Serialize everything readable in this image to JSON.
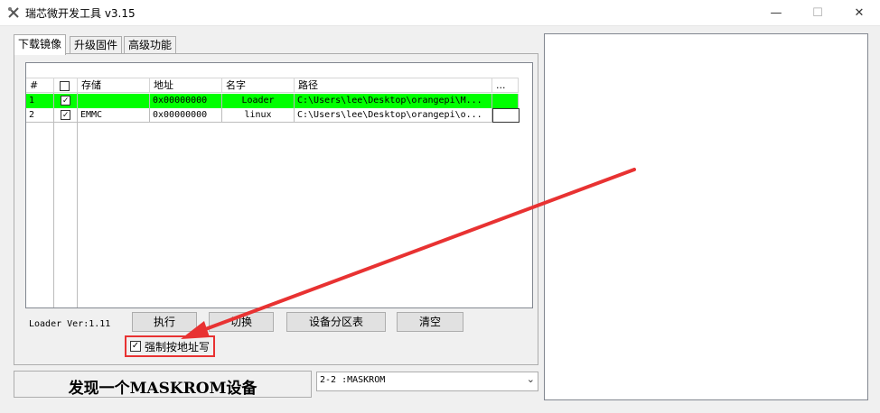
{
  "window": {
    "title": "瑞芯微开发工具 v3.15",
    "min_glyph": "—",
    "max_glyph": "☐",
    "close_glyph": "✕"
  },
  "tabs": [
    {
      "label": "下载镜像",
      "active": true
    },
    {
      "label": "升级固件",
      "active": false
    },
    {
      "label": "高级功能",
      "active": false
    }
  ],
  "table": {
    "columns": [
      "#",
      "",
      "存储",
      "地址",
      "名字",
      "路径",
      "..."
    ],
    "rows": [
      {
        "num": "1",
        "checked": true,
        "storage": "",
        "address": "0x00000000",
        "name": "Loader",
        "path": "C:\\Users\\lee\\Desktop\\orangepi\\M...",
        "selected": true
      },
      {
        "num": "2",
        "checked": true,
        "storage": "EMMC",
        "address": "0x00000000",
        "name": "linux",
        "path": "C:\\Users\\lee\\Desktop\\orangepi\\o...",
        "selected": false
      }
    ],
    "check_glyph": "✓"
  },
  "loader_version": "Loader Ver:1.11",
  "buttons": {
    "run": "执行",
    "switch": "切换",
    "partition_table": "设备分区表",
    "clear": "清空"
  },
  "force_write": {
    "label": "强制按地址写",
    "checked": true
  },
  "status": {
    "text": "发现一个MASKROM设备"
  },
  "device_select": {
    "value": "2-2 :MASKROM"
  },
  "colors": {
    "selected_row": "#00ff00",
    "annotation_red": "#e83232"
  }
}
